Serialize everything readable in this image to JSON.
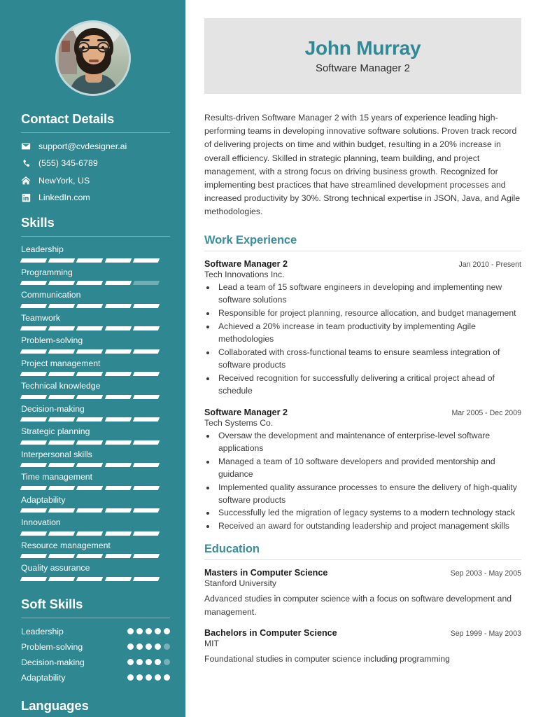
{
  "accent_colors": {
    "sidebar_teal": "#2F8791",
    "heading_teal": "#3A8E9B",
    "name_teal": "#2E8A96",
    "banner_gray": "#E4E4E4"
  },
  "sidebar": {
    "avatar": {
      "alt": "profile-photo"
    },
    "contact": {
      "heading": "Contact Details",
      "items": [
        {
          "icon": "envelope-icon",
          "text": "support@cvdesigner.ai"
        },
        {
          "icon": "phone-icon",
          "text": "(555) 345-6789"
        },
        {
          "icon": "home-icon",
          "text": "NewYork, US"
        },
        {
          "icon": "linkedin-icon",
          "text": "LinkedIn.com"
        }
      ]
    },
    "skills": {
      "heading": "Skills",
      "max": 5,
      "items": [
        {
          "label": "Leadership",
          "level": 5
        },
        {
          "label": "Programming",
          "level": 4
        },
        {
          "label": "Communication",
          "level": 5
        },
        {
          "label": "Teamwork",
          "level": 5
        },
        {
          "label": "Problem-solving",
          "level": 5
        },
        {
          "label": "Project management",
          "level": 5
        },
        {
          "label": "Technical knowledge",
          "level": 5
        },
        {
          "label": "Decision-making",
          "level": 5
        },
        {
          "label": "Strategic planning",
          "level": 5
        },
        {
          "label": "Interpersonal skills",
          "level": 5
        },
        {
          "label": "Time management",
          "level": 5
        },
        {
          "label": "Adaptability",
          "level": 5
        },
        {
          "label": "Innovation",
          "level": 5
        },
        {
          "label": "Resource management",
          "level": 5
        },
        {
          "label": "Quality assurance",
          "level": 5
        }
      ]
    },
    "soft_skills": {
      "heading": "Soft Skills",
      "max": 5,
      "items": [
        {
          "label": "Leadership",
          "level": 5
        },
        {
          "label": "Problem-solving",
          "level": 4
        },
        {
          "label": "Decision-making",
          "level": 4
        },
        {
          "label": "Adaptability",
          "level": 5
        }
      ]
    },
    "languages": {
      "heading": "Languages"
    }
  },
  "main": {
    "name": "John Murray",
    "title": "Software Manager 2",
    "summary": "Results-driven Software Manager 2 with 15 years of experience leading high-performing teams in developing innovative software solutions. Proven track record of delivering projects on time and within budget, resulting in a 20% increase in overall efficiency. Skilled in strategic planning, team building, and project management, with a strong focus on driving business growth. Recognized for implementing best practices that have streamlined development processes and increased productivity by 30%. Strong technical expertise in JSON, Java, and Agile methodologies.",
    "work": {
      "heading": "Work Experience",
      "entries": [
        {
          "role": "Software Manager 2",
          "org": "Tech Innovations Inc.",
          "date": "Jan 2010 - Present",
          "bullets": [
            "Lead a team of 15 software engineers in developing and implementing new software solutions",
            "Responsible for project planning, resource allocation, and budget management",
            "Achieved a 20% increase in team productivity by implementing Agile methodologies",
            "Collaborated with cross-functional teams to ensure seamless integration of software products",
            "Received recognition for successfully delivering a critical project ahead of schedule"
          ]
        },
        {
          "role": "Software Manager 2",
          "org": "Tech Systems Co.",
          "date": "Mar 2005 - Dec 2009",
          "bullets": [
            "Oversaw the development and maintenance of enterprise-level software applications",
            "Managed a team of 10 software developers and provided mentorship and guidance",
            "Implemented quality assurance processes to ensure the delivery of high-quality software products",
            "Successfully led the migration of legacy systems to a modern technology stack",
            "Received an award for outstanding leadership and project management skills"
          ]
        }
      ]
    },
    "education": {
      "heading": "Education",
      "entries": [
        {
          "degree": "Masters in Computer Science",
          "school": "Stanford University",
          "date": "Sep 2003 - May 2005",
          "description": "Advanced studies in computer science with a focus on software development and management."
        },
        {
          "degree": "Bachelors in Computer Science",
          "school": "MIT",
          "date": "Sep 1999 - May 2003",
          "description": "Foundational studies in computer science including programming"
        }
      ]
    }
  }
}
